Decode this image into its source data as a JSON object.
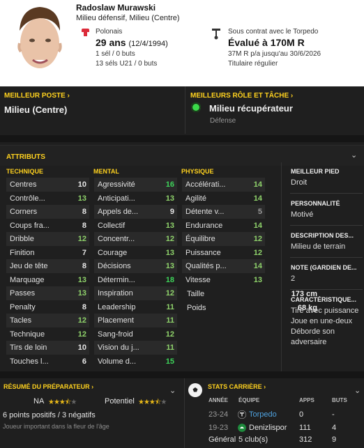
{
  "player": {
    "name": "Radoslaw Murawski",
    "positions": "Milieu défensif, Milieu (Centre)",
    "nationality": "Polonais",
    "age": "29 ans",
    "dob": "(12/4/1994)",
    "caps": "1 sél / 0 buts",
    "u21_caps": "13 séls U21 / 0 buts",
    "contract": "Sous contrat avec le Torpedo",
    "value": "Évalué à 170M R",
    "wage": "37M R p/a jusqu'au 30/6/2026",
    "squad_status": "Titulaire régulier"
  },
  "best_position": {
    "title": "MEILLEUR POSTE ›",
    "value": "Milieu (Centre)"
  },
  "best_role": {
    "title": "MEILLEURS RÔLE ET TÂCHE ›",
    "role": "Milieu récupérateur",
    "duty": "Défense"
  },
  "attributes": {
    "title": "ATTRIBUTS",
    "technical_title": "TECHNIQUE",
    "mental_title": "MENTAL",
    "physical_title": "PHYSIQUE",
    "technical": [
      {
        "name": "Centres",
        "value": "10"
      },
      {
        "name": "Contrôle...",
        "value": "13"
      },
      {
        "name": "Corners",
        "value": "8"
      },
      {
        "name": "Coups fra...",
        "value": "8"
      },
      {
        "name": "Dribble",
        "value": "12"
      },
      {
        "name": "Finition",
        "value": "7"
      },
      {
        "name": "Jeu de tête",
        "value": "8"
      },
      {
        "name": "Marquage",
        "value": "13"
      },
      {
        "name": "Passes",
        "value": "13"
      },
      {
        "name": "Penalty",
        "value": "8"
      },
      {
        "name": "Tacles",
        "value": "12"
      },
      {
        "name": "Technique",
        "value": "12"
      },
      {
        "name": "Tirs de loin",
        "value": "10"
      },
      {
        "name": "Touches l...",
        "value": "6"
      }
    ],
    "mental": [
      {
        "name": "Agressivité",
        "value": "16"
      },
      {
        "name": "Anticipati...",
        "value": "13"
      },
      {
        "name": "Appels de...",
        "value": "9"
      },
      {
        "name": "Collectif",
        "value": "13"
      },
      {
        "name": "Concentr...",
        "value": "12"
      },
      {
        "name": "Courage",
        "value": "13"
      },
      {
        "name": "Décisions",
        "value": "13"
      },
      {
        "name": "Détermin...",
        "value": "18"
      },
      {
        "name": "Inspiration",
        "value": "12"
      },
      {
        "name": "Leadership",
        "value": "11"
      },
      {
        "name": "Placement",
        "value": "11"
      },
      {
        "name": "Sang-froid",
        "value": "12"
      },
      {
        "name": "Vision du j...",
        "value": "11"
      },
      {
        "name": "Volume d...",
        "value": "15"
      }
    ],
    "physical": [
      {
        "name": "Accélérati...",
        "value": "14"
      },
      {
        "name": "Agilité",
        "value": "14"
      },
      {
        "name": "Détente v...",
        "value": "5"
      },
      {
        "name": "Endurance",
        "value": "14"
      },
      {
        "name": "Équilibre",
        "value": "12"
      },
      {
        "name": "Puissance",
        "value": "12"
      },
      {
        "name": "Qualités p...",
        "value": "14"
      },
      {
        "name": "Vitesse",
        "value": "13"
      }
    ],
    "height_label": "Taille",
    "height": "173 cm",
    "weight_label": "Poids",
    "weight": "68 kg"
  },
  "side": {
    "foot_title": "MEILLEUR PIED",
    "foot": "Droit",
    "personality_title": "PERSONNALITÉ",
    "personality": "Motivé",
    "description_title": "DESCRIPTION DES...",
    "description": "Milieu de terrain",
    "gk_title": "NOTE (GARDIEN DE...",
    "gk": "2",
    "traits_title": "CARACTÉRISTIQUE...",
    "traits": [
      "Tire avec puissance",
      "Joue en une-deux",
      "Déborde son adversaire"
    ]
  },
  "coach": {
    "title": "RÉSUMÉ DU PRÉPARATEUR ›",
    "current_label": "NA",
    "current_stars": 3.5,
    "potential_label": "Potentiel",
    "potential_stars": 3.5,
    "points": "6 points positifs / 3 négatifs",
    "summary": "Joueur important dans la fleur de l'âge"
  },
  "career": {
    "title": "STATS CARRIÈRE ›",
    "headers": {
      "year": "ANNÉE",
      "team": "ÉQUIPE",
      "apps": "APPS",
      "goals": "BUTS"
    },
    "rows": [
      {
        "year": "23-24",
        "team": "Torpedo",
        "apps": "0",
        "goals": "-"
      },
      {
        "year": "19-23",
        "team": "Denizlispor",
        "apps": "111",
        "goals": "4"
      }
    ],
    "total": {
      "label": "Général",
      "team": "5 club(s)",
      "apps": "312",
      "goals": "9"
    }
  },
  "colors": {
    "accent": "#ffd21f",
    "good": "#3ed35a",
    "link": "#4fa3e0"
  }
}
